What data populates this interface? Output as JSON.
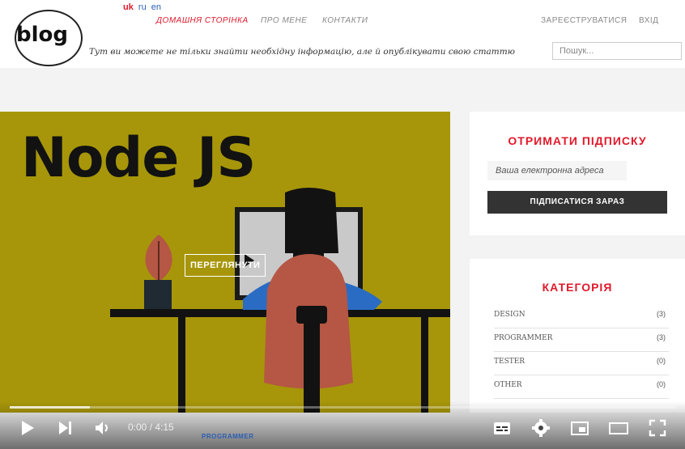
{
  "header": {
    "logo_text": "blog",
    "languages": [
      {
        "label": "uk",
        "active": true
      },
      {
        "label": "ru",
        "active": false
      },
      {
        "label": "en",
        "active": false
      }
    ],
    "nav": [
      {
        "label": "Домашня сторінка",
        "active": true
      },
      {
        "label": "Про мене",
        "active": false
      },
      {
        "label": "Контакти",
        "active": false
      }
    ],
    "register_label": "Зареєструватися",
    "login_label": "Вхід",
    "tagline": "Тут ви можете не тільки знайти необхідну інформацію, але й опублікувати свою статтю",
    "search_placeholder": "Пошук..."
  },
  "hero": {
    "title": "Node JS",
    "watch_label": "ПЕРЕГЛЯНУТИ",
    "background": "#a7960a"
  },
  "subscribe": {
    "title": "ОТРИМАТИ ПІДПИСКУ",
    "email_placeholder": "Ваша електронна адреса",
    "button_label": "ПІДПИСАТИСЯ ЗАРАЗ"
  },
  "categories": {
    "title": "КАТЕГОРІЯ",
    "items": [
      {
        "name": "DESIGN",
        "count": "(3)"
      },
      {
        "name": "PROGRAMMER",
        "count": "(3)"
      },
      {
        "name": "TESTER",
        "count": "(0)"
      },
      {
        "name": "OTHER",
        "count": "(0)"
      }
    ]
  },
  "below_tag": "PROGRAMMER",
  "player": {
    "time": "0:00 / 4:15",
    "buffered_fraction": 0.12,
    "icons": [
      "play-icon",
      "next-icon",
      "volume-icon",
      "subtitles-icon",
      "settings-icon",
      "miniplayer-icon",
      "theater-icon",
      "fullscreen-icon"
    ]
  },
  "colors": {
    "accent": "#e0192b",
    "link": "#2b5fb4",
    "button": "#333333"
  }
}
